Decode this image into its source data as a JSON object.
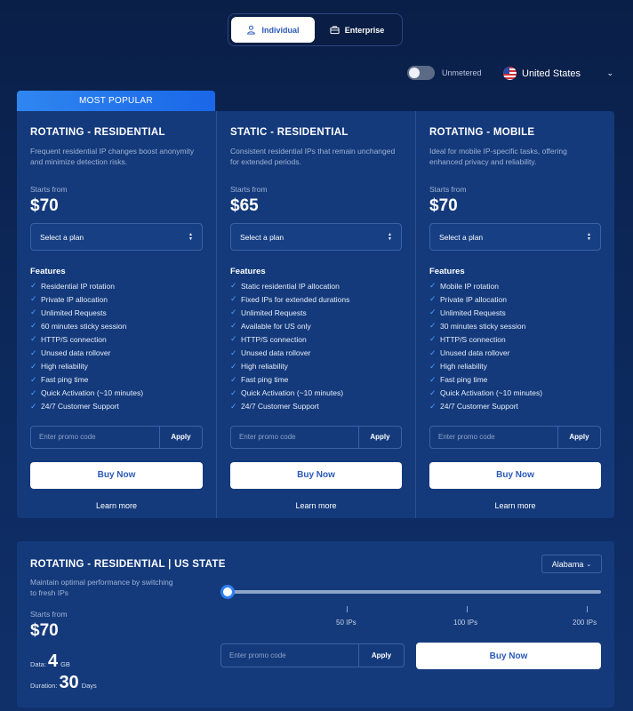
{
  "tabs": {
    "individual": "Individual",
    "enterprise": "Enterprise"
  },
  "filters": {
    "unmetered_label": "Unmetered",
    "unmetered_on": false,
    "country": "United States"
  },
  "badge": {
    "most_popular": "MOST POPULAR"
  },
  "plans": [
    {
      "title": "ROTATING - RESIDENTIAL",
      "description": "Frequent residential IP changes boost anonymity and minimize detection risks.",
      "starts_from": "Starts from",
      "price": "$70",
      "select_placeholder": "Select a plan",
      "features_title": "Features",
      "features": [
        "Residential IP rotation",
        "Private IP allocation",
        "Unlimited Requests",
        "60 minutes sticky session",
        "HTTP/S connection",
        "Unused data rollover",
        "High reliability",
        "Fast ping time",
        "Quick Activation (~10 minutes)",
        "24/7 Customer Support"
      ],
      "promo_placeholder": "Enter promo code",
      "apply": "Apply",
      "buy": "Buy Now",
      "learn": "Learn more"
    },
    {
      "title": "STATIC - RESIDENTIAL",
      "description": "Consistent residential IPs that remain unchanged for extended periods.",
      "starts_from": "Starts from",
      "price": "$65",
      "select_placeholder": "Select a plan",
      "features_title": "Features",
      "features": [
        "Static residential IP allocation",
        "Fixed IPs for extended durations",
        "Unlimited Requests",
        "Available for US only",
        "HTTP/S connection",
        "Unused data rollover",
        "High reliability",
        "Fast ping time",
        "Quick Activation (~10 minutes)",
        "24/7 Customer Support"
      ],
      "promo_placeholder": "Enter promo code",
      "apply": "Apply",
      "buy": "Buy Now",
      "learn": "Learn more"
    },
    {
      "title": "ROTATING - MOBILE",
      "description": "Ideal for mobile IP-specific tasks, offering enhanced privacy and reliability.",
      "starts_from": "Starts from",
      "price": "$70",
      "select_placeholder": "Select a plan",
      "features_title": "Features",
      "features": [
        "Mobile IP rotation",
        "Private IP allocation",
        "Unlimited Requests",
        "30 minutes sticky session",
        "HTTP/S connection",
        "Unused data rollover",
        "High reliability",
        "Fast ping time",
        "Quick Activation (~10 minutes)",
        "24/7 Customer Support"
      ],
      "promo_placeholder": "Enter promo code",
      "apply": "Apply",
      "buy": "Buy Now",
      "learn": "Learn more"
    }
  ],
  "state_plan": {
    "title": "ROTATING - RESIDENTIAL | US STATE",
    "description": "Maintain optimal performance by switching to fresh IPs",
    "state": "Alabama",
    "starts_from": "Starts from",
    "price": "$70",
    "data_label": "Data:",
    "data_value": "4",
    "data_unit": "GB",
    "duration_label": "Duration:",
    "duration_value": "30",
    "duration_unit": "Days",
    "slider_ticks": [
      "50 IPs",
      "100 IPs",
      "200 IPs"
    ],
    "slider_position": 0,
    "promo_placeholder": "Enter promo code",
    "apply": "Apply",
    "buy": "Buy Now"
  },
  "colors": {
    "background": "#0a1f48",
    "card": "#143a7c",
    "accent": "#2f7ff0",
    "check": "#47a0ff"
  }
}
